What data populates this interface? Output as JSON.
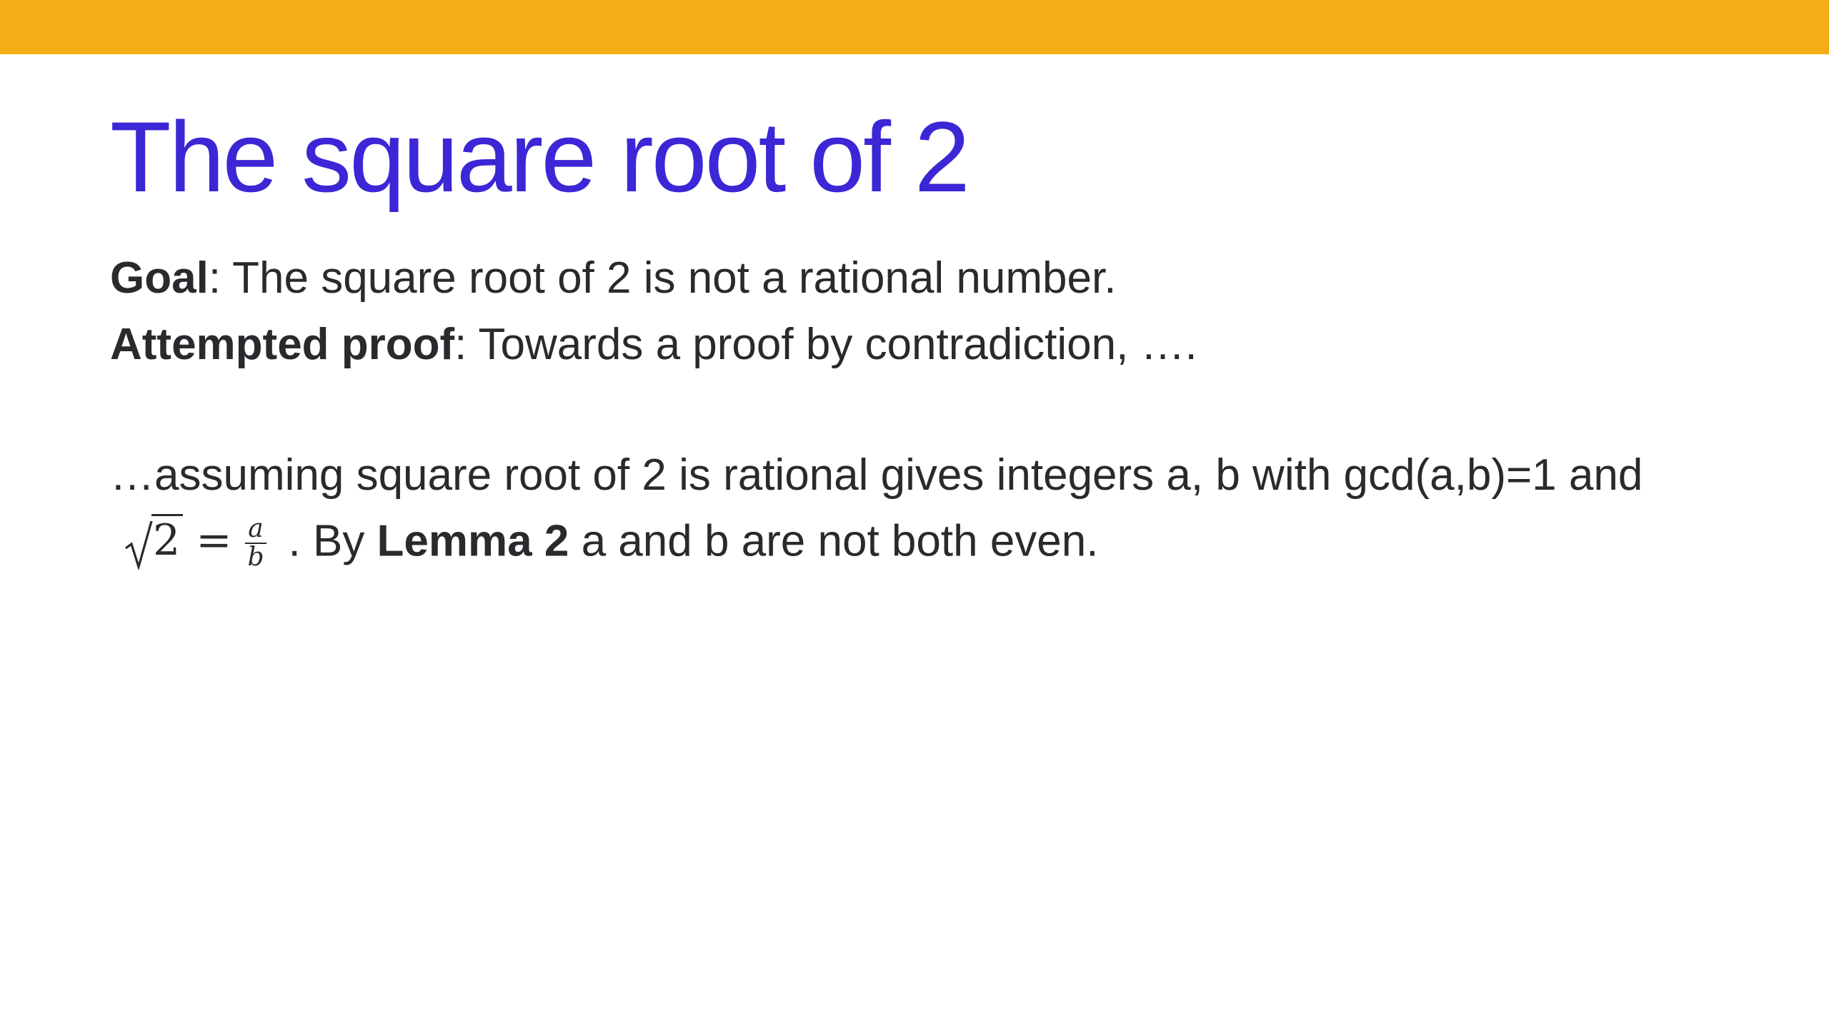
{
  "theme": {
    "bar_color": "#F2AE14",
    "title_color": "#3B27D6",
    "text_color": "#2A2A2E"
  },
  "title": "The square root of 2",
  "goal": {
    "label": "Goal",
    "text": ": The square root of 2 is not a rational number."
  },
  "attempted_proof": {
    "label": "Attempted proof",
    "text": ": Towards a proof by contradiction, …."
  },
  "assumption_line": "…assuming square root of 2 is rational gives integers a, b with gcd(a,b)=1 and",
  "formula": {
    "radicand": "2",
    "equals": "=",
    "numerator": "a",
    "denominator": "b"
  },
  "conclusion": {
    "prefix": ". By ",
    "lemma": "Lemma 2",
    "suffix": " a and b are not both even."
  }
}
